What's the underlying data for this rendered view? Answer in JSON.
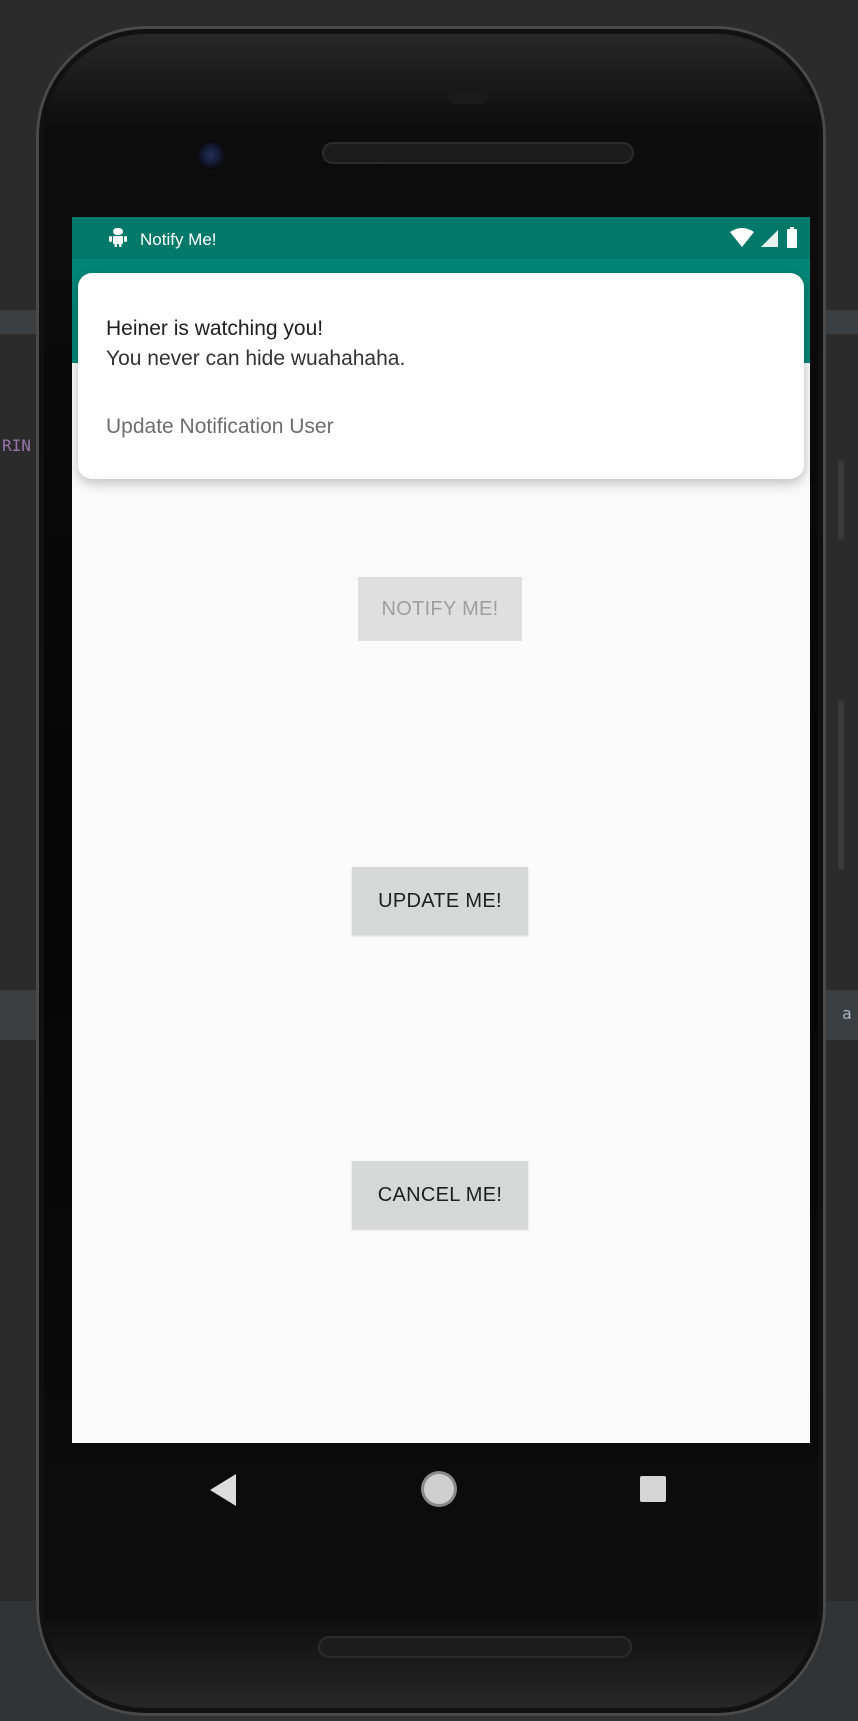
{
  "ide": {
    "left_fragment": "RIN",
    "right_fragment": "a"
  },
  "status_bar": {
    "app_name": "Notify Me!",
    "icons": [
      "android-icon",
      "wifi-icon",
      "cellular-signal-icon",
      "battery-icon"
    ]
  },
  "notification": {
    "title": "Heiner is watching you!",
    "text": "You never can hide wuahahaha.",
    "action_label": "Update Notification User"
  },
  "buttons": {
    "notify_label": "NOTIFY ME!",
    "notify_enabled": false,
    "update_label": "UPDATE ME!",
    "cancel_label": "CANCEL ME!"
  },
  "nav_bar": {
    "icons": [
      "back-icon",
      "home-icon",
      "recents-icon"
    ]
  },
  "colors": {
    "status_bar": "#00786a",
    "app_bar": "#008577",
    "button": "#d6d7d7",
    "screen_background": "#fafafa"
  }
}
